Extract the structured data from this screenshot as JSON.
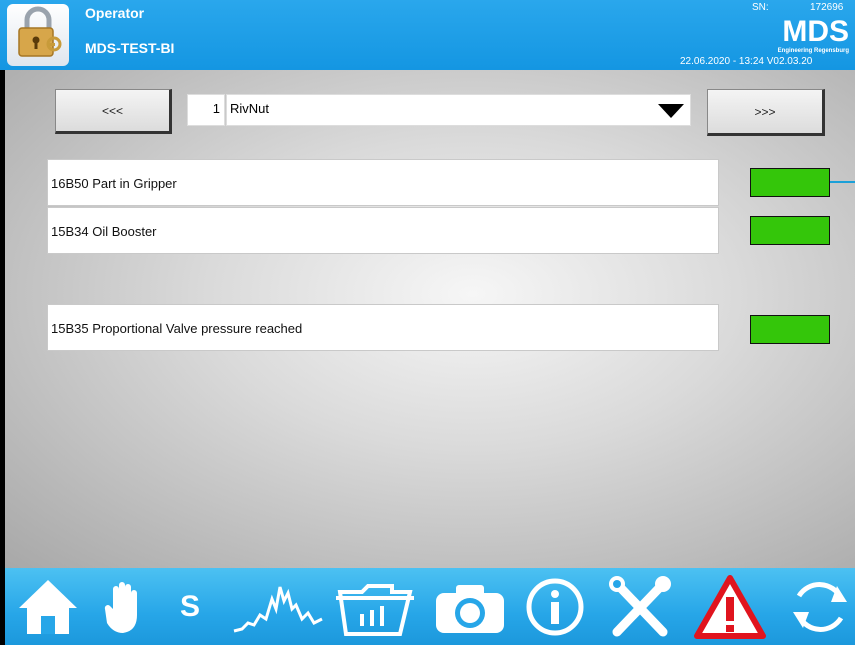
{
  "header": {
    "role": "Operator",
    "machine": "MDS-TEST-BI",
    "sn_label": "SN:",
    "sn_value": "172696",
    "logo_text": "MDS",
    "logo_subtext": "Engineering Regensburg",
    "datetime": "22.06.2020 - 13:24   V02.03.20"
  },
  "nav": {
    "prev_label": "<<<",
    "next_label": ">>>",
    "program_number": "1",
    "program_name": "RivNut"
  },
  "signals": [
    {
      "label": "16B50 Part in Gripper",
      "status": "on"
    },
    {
      "label": "15B34 Oil Booster",
      "status": "on"
    },
    {
      "label": "15B35 Proportional Valve pressure reached",
      "status": "on"
    }
  ],
  "colors": {
    "header_blue": "#1496e2",
    "led_green": "#34c60a",
    "warning_red": "#e0141e"
  },
  "toolbar": {
    "items": [
      {
        "icon": "home-icon"
      },
      {
        "icon": "hand-icon"
      },
      {
        "icon": "s-icon",
        "text": "S"
      },
      {
        "icon": "chart-icon"
      },
      {
        "icon": "folder-icon"
      },
      {
        "icon": "camera-icon"
      },
      {
        "icon": "info-icon"
      },
      {
        "icon": "tools-icon"
      },
      {
        "icon": "warning-icon"
      },
      {
        "icon": "refresh-icon"
      }
    ]
  }
}
